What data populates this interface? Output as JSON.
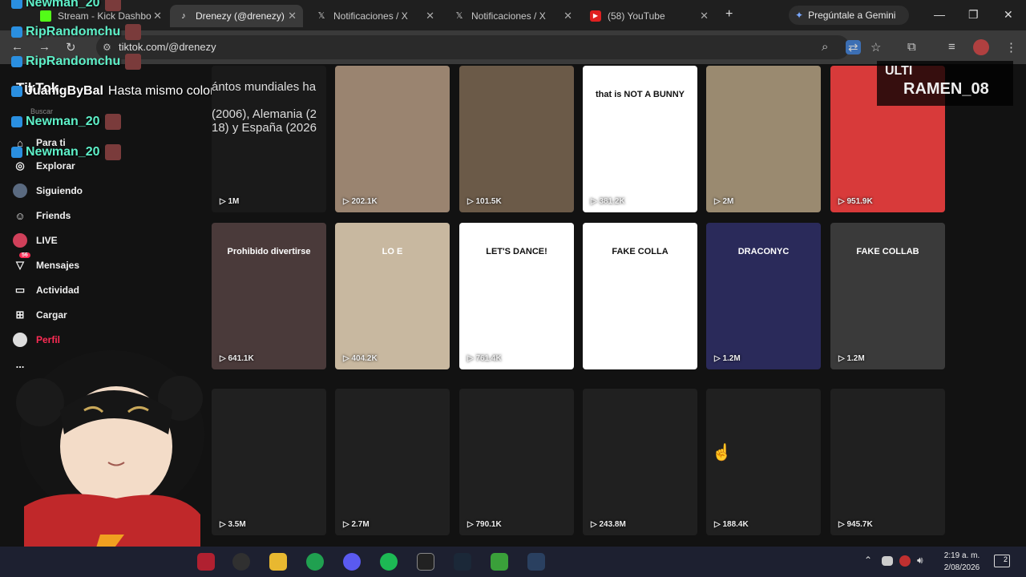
{
  "tabs": [
    {
      "title": "Stream - Kick Dashbo",
      "icon": "kick-icon"
    },
    {
      "title": "Drenezy (@drenezy)",
      "icon": "tiktok-icon"
    },
    {
      "title": "Notificaciones / X",
      "icon": "x-icon"
    },
    {
      "title": "Notificaciones / X",
      "icon": "x-icon"
    },
    {
      "title": "(58) YouTube",
      "icon": "youtube-icon"
    }
  ],
  "gemini_label": "Pregúntale a Gemini",
  "url": "tiktok.com/@drenezy",
  "sidebar": {
    "logo": "TikTok",
    "search_placeholder": "Buscar",
    "items": [
      {
        "label": "Para ti",
        "icon": "home-icon"
      },
      {
        "label": "Explorar",
        "icon": "compass-icon"
      },
      {
        "label": "Siguiendo",
        "icon": "following-avatar-icon"
      },
      {
        "label": "Friends",
        "icon": "friends-icon"
      },
      {
        "label": "LIVE",
        "icon": "live-icon"
      },
      {
        "label": "Mensajes",
        "icon": "messages-icon",
        "badge": "56"
      },
      {
        "label": "Actividad",
        "icon": "activity-icon"
      },
      {
        "label": "Cargar",
        "icon": "upload-icon"
      },
      {
        "label": "Perfil",
        "icon": "profile-icon"
      },
      {
        "label": "...",
        "icon": "more-icon"
      }
    ]
  },
  "chat": [
    {
      "user": "Newman_20",
      "message": ""
    },
    {
      "user": "RipRandomchu",
      "message": ""
    },
    {
      "user": "RipRandomchu",
      "message": ""
    },
    {
      "user": "JuanigByBal",
      "message": "Hasta mismo color"
    },
    {
      "user": "Newman_20",
      "message": ""
    },
    {
      "user": "Newman_20",
      "message": ""
    }
  ],
  "overlay": {
    "top": "ULTI",
    "name": "RAMEN_08"
  },
  "videos": [
    {
      "views": "1M",
      "text": "ántos mundiales ha\n\n(2006), Alemania (2\n18) y España (2026",
      "color": "#1a1a1a"
    },
    {
      "views": "202.1K",
      "text": "",
      "color": "#9a8470"
    },
    {
      "views": "101.5K",
      "text": "",
      "color": "#6b5a48"
    },
    {
      "views": "381.2K",
      "text": "that is NOT A BUNNY",
      "color": "#ffffff"
    },
    {
      "views": "2M",
      "text": "",
      "color": "#9a8a70"
    },
    {
      "views": "951.9K",
      "text": "",
      "color": "#d83a3a"
    },
    {
      "views": "641.1K",
      "text": "Prohibido divertirse",
      "color": "#4a3a3a"
    },
    {
      "views": "404.2K",
      "text": "LO E",
      "color": "#c8b8a0"
    },
    {
      "views": "761.4K",
      "text": "LET'S DANCE!",
      "color": "#ffffff"
    },
    {
      "views": "",
      "text": "FAKE COLLA",
      "color": "#ffffff"
    },
    {
      "views": "1.2M",
      "text": "DRACONYC",
      "color": "#2a2a5a"
    },
    {
      "views": "1.2M",
      "text": "FAKE COLLAB",
      "color": "#3a3a3a"
    },
    {
      "views": "3.5M",
      "text": "",
      "color": "#202020"
    },
    {
      "views": "2.7M",
      "text": "",
      "color": "#202020"
    },
    {
      "views": "790.1K",
      "text": "",
      "color": "#202020"
    },
    {
      "views": "243.8M",
      "text": "",
      "color": "#202020"
    },
    {
      "views": "188.4K",
      "text": "",
      "color": "#202020"
    },
    {
      "views": "945.7K",
      "text": "",
      "color": "#202020"
    }
  ],
  "clock": {
    "time": "2:19 a. m.",
    "date": "2/08/2026"
  },
  "notifications_count": "2"
}
